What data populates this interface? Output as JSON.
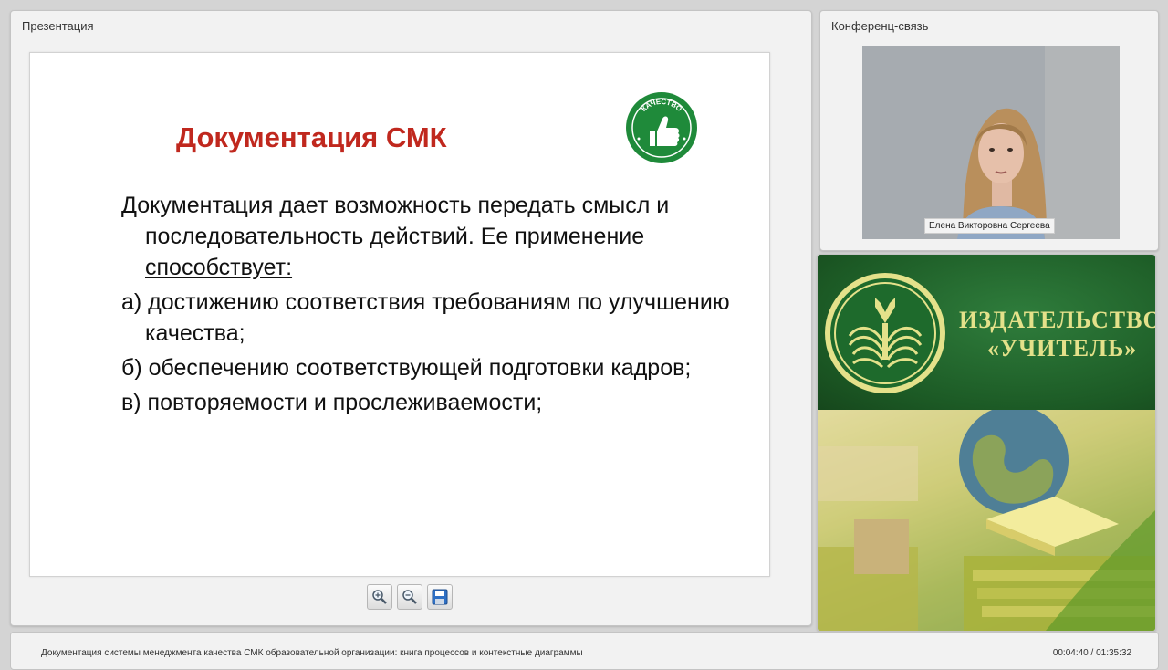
{
  "presentation_panel": {
    "title": "Презентация"
  },
  "slide": {
    "title": "Документация СМК",
    "badge_text": "КАЧЕСТВО",
    "intro_before": "Документация дает возможность передать смысл и последовательность действий. Ее применение ",
    "intro_underlined": "способствует:",
    "items": [
      "а) достижению соответствия требованиям по улучшению качества;",
      "б) обеспечению соответствующей подготовки кадров;",
      "в) повторяемости и прослеживаемости;"
    ]
  },
  "toolbar": {
    "zoom_in": "zoom-in",
    "zoom_out": "zoom-out",
    "save": "save"
  },
  "conference_panel": {
    "title": "Конференц-связь",
    "participant_name": "Елена Викторовна Сергеева"
  },
  "promo": {
    "line1": "ИЗДАТЕЛЬСТВО",
    "line2": "«УЧИТЕЛЬ»"
  },
  "footer": {
    "title": "Документация системы менеджмента качества СМК образовательной организации: книга процессов и контекстные диаграммы",
    "time": "00:04:40 / 01:35:32"
  },
  "colors": {
    "slide_title": "#c0281e",
    "badge_green": "#1f8a3a",
    "promo_green": "#1c5a25",
    "promo_text": "#e4e18a"
  }
}
